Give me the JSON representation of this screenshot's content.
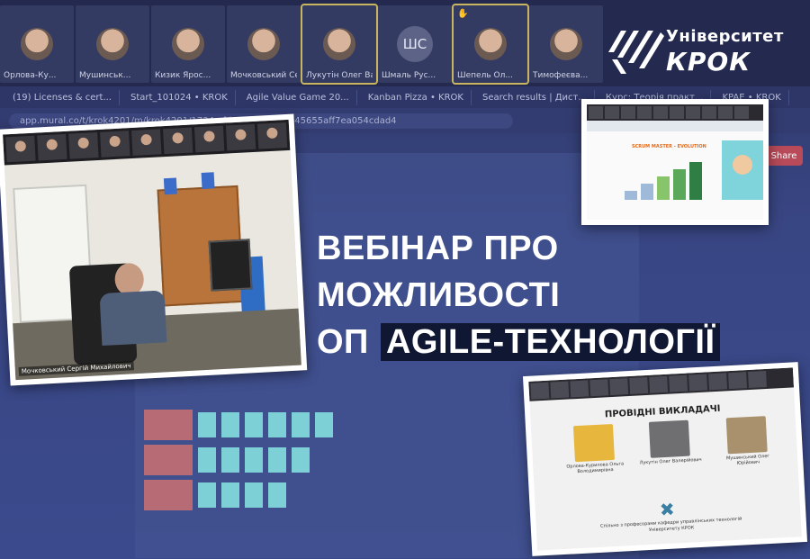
{
  "participants": [
    {
      "name": "Орлова-Ку...",
      "initials": ""
    },
    {
      "name": "Мушинськ...",
      "initials": ""
    },
    {
      "name": "Кизик Ярос...",
      "initials": ""
    },
    {
      "name": "Мочковський Се...",
      "initials": ""
    },
    {
      "name": "Лукутін Олег Ва...",
      "initials": ""
    },
    {
      "name": "Шмаль Рус...",
      "initials": "ШС"
    },
    {
      "name": "Шепель Ол...",
      "initials": ""
    },
    {
      "name": "Тимофеєва...",
      "initials": ""
    }
  ],
  "browser": {
    "tabs": [
      "(19) Licenses & cert...",
      "Start_101024 • KROK",
      "Agile Value Game 20...",
      "Kanban Pizza • KROK",
      "Search results | Дист...",
      "Курс: Теорія практ...",
      "KPAE • KROK"
    ],
    "url": "app.mural.co/t/krok4201/m/krok4201/1734...fd193178b629d45655aff7ea054cdad4",
    "share_label": "Share"
  },
  "logo": {
    "university": "Університет",
    "krok": "КРОК"
  },
  "headline": {
    "line1": "ВЕБІНАР ПРО",
    "line2": "МОЖЛИВОСТІ",
    "line3_prefix": "ОП",
    "line3_highlight": "AGILE-ТЕХНОЛОГІЇ"
  },
  "photo_left": {
    "caption": "Мочковський Сергій Михайлович"
  },
  "photo_topright": {
    "slide_title": "SCRUM MASTER - EVOLUTION"
  },
  "photo_bottomright": {
    "title": "ПРОВІДНІ ВИКЛАДАЧІ",
    "lecturers": [
      {
        "name": "Орлова-Курилова Ольга Володимирівна"
      },
      {
        "name": "Лукутін Олег Валерійович"
      },
      {
        "name": "Мушинський Олег Юрійович"
      }
    ],
    "footer": "Спільно з професорами кафедри управлінських технологій Університету КРОК"
  },
  "colors": {
    "background": "#2f3a6b",
    "headline_highlight": "#0f1733",
    "accent_orange": "#e36a1a"
  }
}
